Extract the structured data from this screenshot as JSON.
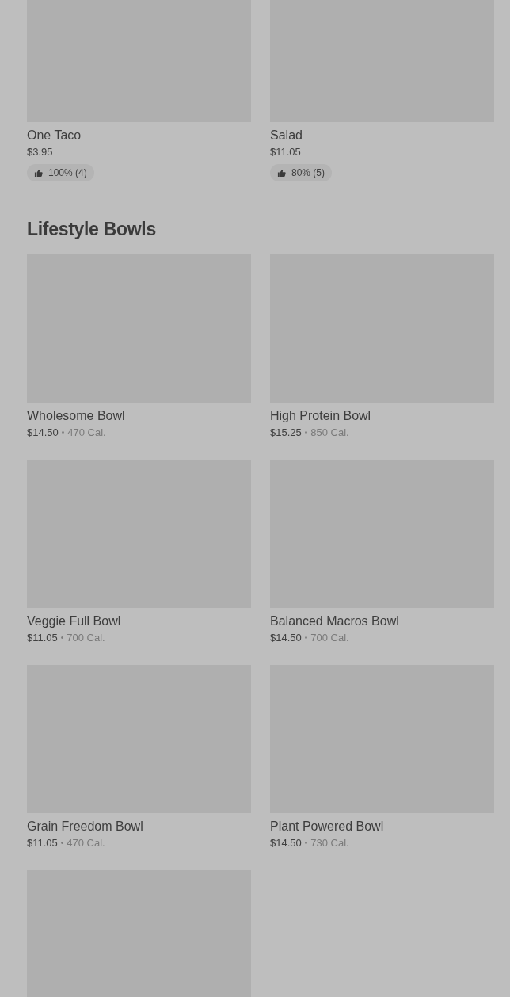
{
  "sections": [
    {
      "items": [
        {
          "kind": "dish",
          "name": "One Taco",
          "price": "$3.95",
          "rating": {
            "text": "100% (4)"
          }
        },
        {
          "kind": "dish",
          "name": "Salad",
          "price": "$11.05",
          "rating": {
            "text": "80% (5)"
          }
        }
      ]
    },
    {
      "title": "Lifestyle Bowls",
      "items": [
        {
          "kind": "dish",
          "name": "Wholesome Bowl",
          "price": "$14.50",
          "separator": "•",
          "calories": "470 Cal."
        },
        {
          "kind": "dish",
          "name": "High Protein Bowl",
          "price": "$15.25",
          "separator": "•",
          "calories": "850 Cal."
        },
        {
          "kind": "dish",
          "name": "Veggie Full Bowl",
          "price": "$11.05",
          "separator": "•",
          "calories": "700 Cal."
        },
        {
          "kind": "dish",
          "name": "Balanced Macros Bowl",
          "price": "$14.50",
          "separator": "•",
          "calories": "700 Cal."
        },
        {
          "kind": "dish",
          "name": "Grain Freedom Bowl",
          "price": "$11.05",
          "separator": "•",
          "calories": "470 Cal."
        },
        {
          "kind": "dish",
          "name": "Plant Powered Bowl",
          "price": "$14.50",
          "separator": "•",
          "calories": "730 Cal."
        },
        {
          "kind": "image_only"
        }
      ]
    }
  ]
}
